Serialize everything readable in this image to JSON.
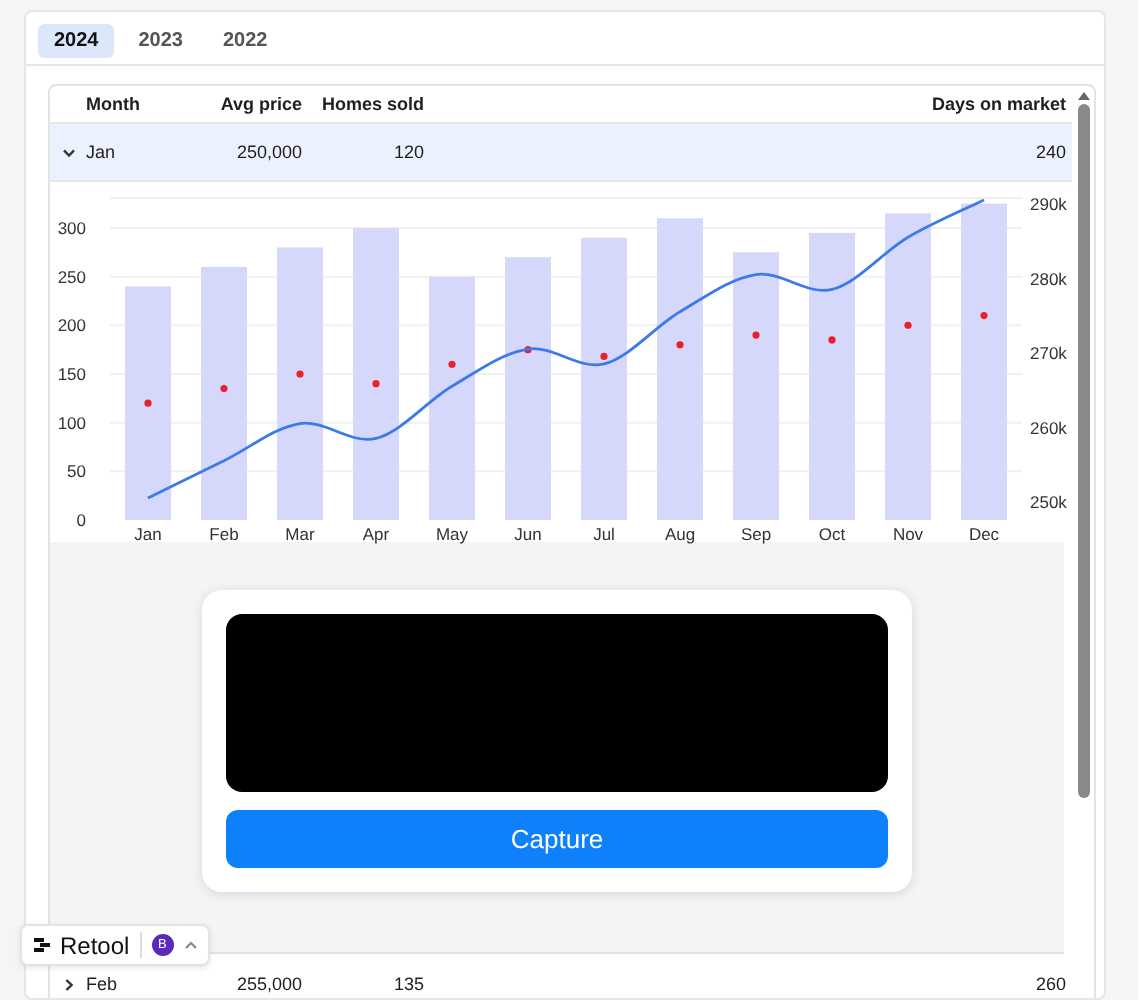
{
  "tabs": [
    {
      "label": "2024",
      "selected": true
    },
    {
      "label": "2023",
      "selected": false
    },
    {
      "label": "2022",
      "selected": false
    }
  ],
  "table": {
    "columns": [
      "Month",
      "Avg price",
      "Homes sold",
      "Days on market"
    ],
    "rows": [
      {
        "month": "Jan",
        "avg_price": "250,000",
        "homes_sold": "120",
        "days_on_market": "240",
        "expanded": true,
        "detail": {
          "chart_data": {
            "type": "bar",
            "categories": [
              "Jan",
              "Feb",
              "Mar",
              "Apr",
              "May",
              "Jun",
              "Jul",
              "Aug",
              "Sep",
              "Oct",
              "Nov",
              "Dec"
            ],
            "series": [
              {
                "color": "#d6d8fb",
                "values": [
                  240,
                  260,
                  280,
                  300,
                  250,
                  270,
                  290,
                  310,
                  275,
                  295,
                  315,
                  325
                ]
              },
              {
                "type": "scatter",
                "color": "#e8212b",
                "values": [
                  120,
                  135,
                  150,
                  140,
                  160,
                  175,
                  168,
                  180,
                  190,
                  185,
                  200,
                  210
                ]
              },
              {
                "type": "line",
                "axis": "y2",
                "color": "#3b7ae8",
                "values": [
                  250000,
                  255000,
                  260000,
                  258000,
                  265000,
                  270000,
                  268000,
                  275000,
                  280000,
                  278000,
                  285000,
                  290000
                ]
              }
            ],
            "grid": true,
            "ylim": [
              0,
              330.8
            ],
            "yticks": [
              0,
              50,
              100,
              150,
              200,
              250,
              300
            ],
            "y2lim": [
              247050,
              290270
            ],
            "y2ticks": [
              {
                "value": 250000,
                "label": "250k"
              },
              {
                "value": 260000,
                "label": "260k"
              },
              {
                "value": 270000,
                "label": "270k"
              },
              {
                "value": 280000,
                "label": "280k"
              },
              {
                "value": 290000,
                "label": "290k"
              }
            ]
          },
          "capture": {
            "button": "Capture"
          }
        }
      },
      {
        "month": "Feb",
        "avg_price": "255,000",
        "homes_sold": "135",
        "days_on_market": "260",
        "expanded": false
      }
    ]
  },
  "badge": {
    "brand": "Retool",
    "avatar": "B"
  }
}
